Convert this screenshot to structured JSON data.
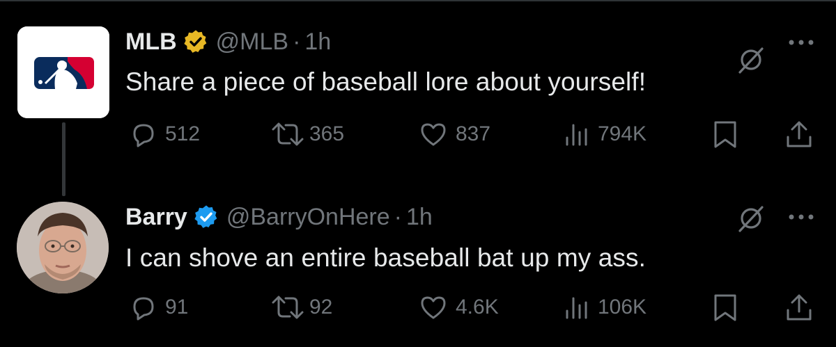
{
  "colors": {
    "background": "#000000",
    "text_primary": "#e7e9ea",
    "text_secondary": "#71767b",
    "gold_badge": "#e8b825",
    "blue_badge": "#1d9bf0",
    "mlb_blue": "#0a2c5c",
    "mlb_red": "#d50032"
  },
  "tweets": [
    {
      "name": "MLB",
      "badge": "gold-verified-icon",
      "handle": "@MLB",
      "dot": "·",
      "time": "1h",
      "text": "Share a piece of baseball lore about yourself!",
      "stats": {
        "replies": "512",
        "reposts": "365",
        "likes": "837",
        "views": "794K"
      }
    },
    {
      "name": "Barry",
      "badge": "blue-verified-icon",
      "handle": "@BarryOnHere",
      "dot": "·",
      "time": "1h",
      "text": "I can shove an entire baseball bat up my ass.",
      "stats": {
        "replies": "91",
        "reposts": "92",
        "likes": "4.6K",
        "views": "106K"
      }
    }
  ]
}
